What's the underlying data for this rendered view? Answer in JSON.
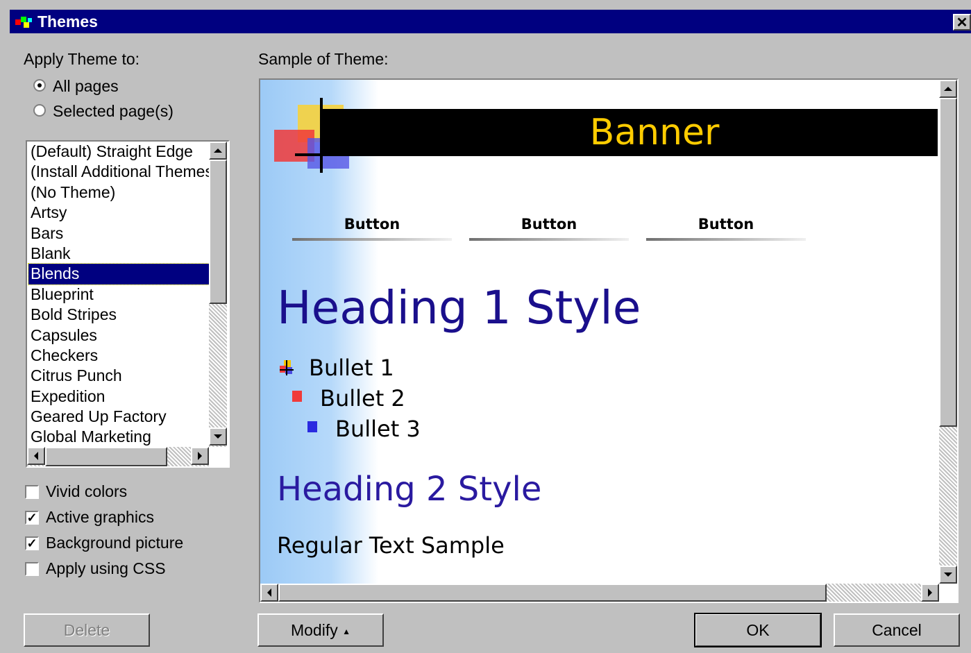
{
  "window": {
    "title": "Themes",
    "close_glyph": "✕"
  },
  "apply": {
    "label": "Apply Theme to:",
    "options": [
      "All pages",
      "Selected page(s)"
    ],
    "selected": "All pages"
  },
  "themes": {
    "items": [
      "(Default) Straight Edge",
      "(Install Additional Themes)",
      "(No Theme)",
      "Artsy",
      "Bars",
      "Blank",
      "Blends",
      "Blueprint",
      "Bold Stripes",
      "Capsules",
      "Checkers",
      "Citrus Punch",
      "Expedition",
      "Geared Up Factory",
      "Global Marketing"
    ],
    "selected": "Blends"
  },
  "options": {
    "vivid_colors": {
      "label": "Vivid colors",
      "checked": false
    },
    "active_graphics": {
      "label": "Active graphics",
      "checked": true
    },
    "background_picture": {
      "label": "Background picture",
      "checked": true
    },
    "apply_css": {
      "label": "Apply using CSS",
      "checked": false
    }
  },
  "sample": {
    "label": "Sample of Theme:",
    "banner": "Banner",
    "buttons": [
      "Button",
      "Button",
      "Button"
    ],
    "heading1": "Heading 1 Style",
    "bullets": [
      "Bullet 1",
      "Bullet 2",
      "Bullet 3"
    ],
    "heading2": "Heading 2 Style",
    "regular": "Regular Text Sample",
    "colors": {
      "banner_text": "#ffcc00",
      "heading": "#1a0f8c",
      "side_gradient": "#9ccaf6"
    }
  },
  "buttons": {
    "delete": "Delete",
    "modify": "Modify",
    "ok": "OK",
    "cancel": "Cancel"
  },
  "colors": {
    "titlebar": "#000080",
    "face": "#c0c0c0",
    "selection": "#000080"
  }
}
